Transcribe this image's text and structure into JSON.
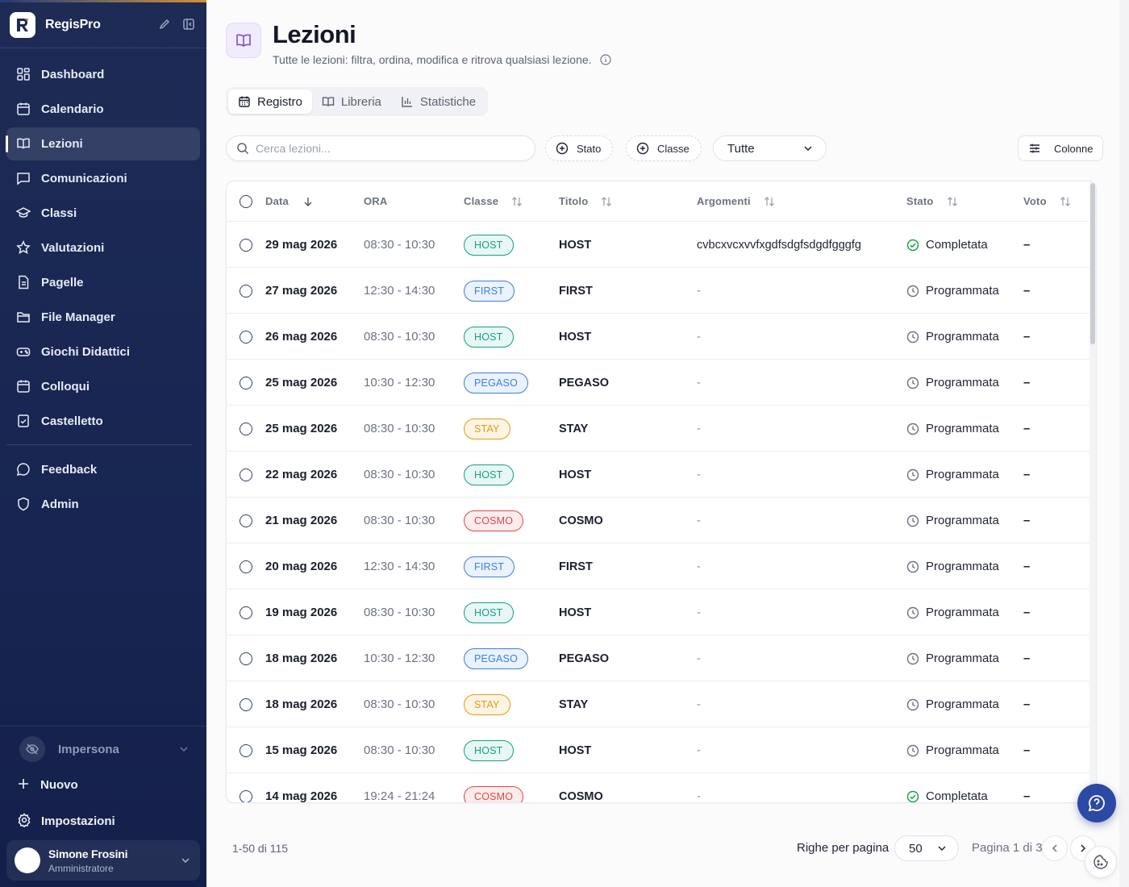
{
  "app": {
    "name": "RegisPro"
  },
  "sidebar": {
    "items": [
      {
        "label": "Dashboard",
        "icon": "dashboard-icon"
      },
      {
        "label": "Calendario",
        "icon": "calendar-icon"
      },
      {
        "label": "Lezioni",
        "icon": "book-open-icon",
        "active": true
      },
      {
        "label": "Comunicazioni",
        "icon": "message-icon"
      },
      {
        "label": "Classi",
        "icon": "graduation-cap-icon"
      },
      {
        "label": "Valutazioni",
        "icon": "star-icon"
      },
      {
        "label": "Pagelle",
        "icon": "report-card-icon"
      },
      {
        "label": "File Manager",
        "icon": "folder-icon"
      },
      {
        "label": "Giochi Didattici",
        "icon": "gamepad-icon"
      },
      {
        "label": "Colloqui",
        "icon": "calendar-icon"
      },
      {
        "label": "Castelletto",
        "icon": "clipboard-check-icon"
      }
    ],
    "secondary": [
      {
        "label": "Feedback",
        "icon": "message-circle-icon"
      },
      {
        "label": "Admin",
        "icon": "shield-icon"
      }
    ],
    "impersona": "Impersona",
    "new_label": "Nuovo",
    "settings_label": "Impostazioni",
    "user": {
      "name": "Simone Frosini",
      "role": "Amministratore"
    }
  },
  "page": {
    "title": "Lezioni",
    "subtitle": "Tutte le lezioni: filtra, ordina, modifica e ritrova qualsiasi lezione.",
    "tabs": [
      {
        "label": "Registro",
        "icon": "calendar-icon",
        "active": true
      },
      {
        "label": "Libreria",
        "icon": "book-open-icon"
      },
      {
        "label": "Statistiche",
        "icon": "bar-chart-icon"
      }
    ]
  },
  "toolbar": {
    "search_placeholder": "Cerca lezioni...",
    "filter_status": "Stato",
    "filter_class": "Classe",
    "select_value": "Tutte",
    "columns_label": "Colonne"
  },
  "table": {
    "columns": {
      "date": "Data",
      "time": "ORA",
      "class": "Classe",
      "title": "Titolo",
      "topics": "Argomenti",
      "status": "Stato",
      "grade": "Voto"
    },
    "rows": [
      {
        "date": "29 mag 2026",
        "time": "08:30 - 10:30",
        "class": "HOST",
        "title": "HOST",
        "topics": "cvbcxvcxvvfxgdfsdgfsdgdfgggfg",
        "status": "Completata",
        "grade": "–"
      },
      {
        "date": "27 mag 2026",
        "time": "12:30 - 14:30",
        "class": "FIRST",
        "title": "FIRST",
        "topics": "-",
        "status": "Programmata",
        "grade": "–"
      },
      {
        "date": "26 mag 2026",
        "time": "08:30 - 10:30",
        "class": "HOST",
        "title": "HOST",
        "topics": "-",
        "status": "Programmata",
        "grade": "–"
      },
      {
        "date": "25 mag 2026",
        "time": "10:30 - 12:30",
        "class": "PEGASO",
        "title": "PEGASO",
        "topics": "-",
        "status": "Programmata",
        "grade": "–"
      },
      {
        "date": "25 mag 2026",
        "time": "08:30 - 10:30",
        "class": "STAY",
        "title": "STAY",
        "topics": "-",
        "status": "Programmata",
        "grade": "–"
      },
      {
        "date": "22 mag 2026",
        "time": "08:30 - 10:30",
        "class": "HOST",
        "title": "HOST",
        "topics": "-",
        "status": "Programmata",
        "grade": "–"
      },
      {
        "date": "21 mag 2026",
        "time": "08:30 - 10:30",
        "class": "COSMO",
        "title": "COSMO",
        "topics": "-",
        "status": "Programmata",
        "grade": "–"
      },
      {
        "date": "20 mag 2026",
        "time": "12:30 - 14:30",
        "class": "FIRST",
        "title": "FIRST",
        "topics": "-",
        "status": "Programmata",
        "grade": "–"
      },
      {
        "date": "19 mag 2026",
        "time": "08:30 - 10:30",
        "class": "HOST",
        "title": "HOST",
        "topics": "-",
        "status": "Programmata",
        "grade": "–"
      },
      {
        "date": "18 mag 2026",
        "time": "10:30 - 12:30",
        "class": "PEGASO",
        "title": "PEGASO",
        "topics": "-",
        "status": "Programmata",
        "grade": "–"
      },
      {
        "date": "18 mag 2026",
        "time": "08:30 - 10:30",
        "class": "STAY",
        "title": "STAY",
        "topics": "-",
        "status": "Programmata",
        "grade": "–"
      },
      {
        "date": "15 mag 2026",
        "time": "08:30 - 10:30",
        "class": "HOST",
        "title": "HOST",
        "topics": "-",
        "status": "Programmata",
        "grade": "–"
      },
      {
        "date": "14 mag 2026",
        "time": "19:24 - 21:24",
        "class": "COSMO",
        "title": "COSMO",
        "topics": "-",
        "status": "Completata",
        "grade": "–"
      }
    ]
  },
  "class_colors": {
    "HOST": "#14a08a",
    "FIRST": "#3b7fe0",
    "PEGASO": "#3b7fe0",
    "STAY": "#e49b14",
    "COSMO": "#e04848"
  },
  "status_colors": {
    "Completata": "#16a34a",
    "Programmata": "#6b7280"
  },
  "pagination": {
    "range": "1-50 di 115",
    "rows_per_page_label": "Righe per pagina",
    "rows_per_page": "50",
    "page_label": "Pagina 1 di 3"
  }
}
